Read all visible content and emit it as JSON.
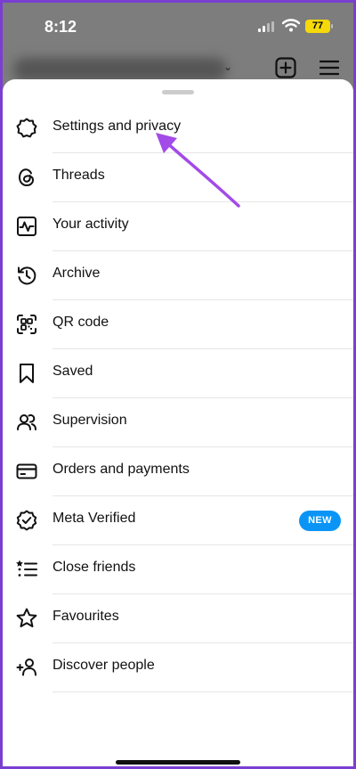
{
  "status": {
    "time": "8:12",
    "battery": "77"
  },
  "header": {
    "create_icon": "plus-square-icon",
    "menu_icon": "hamburger-icon"
  },
  "menu": {
    "items": [
      {
        "label": "Settings and privacy",
        "icon": "gear-icon"
      },
      {
        "label": "Threads",
        "icon": "threads-icon"
      },
      {
        "label": "Your activity",
        "icon": "activity-icon"
      },
      {
        "label": "Archive",
        "icon": "archive-icon"
      },
      {
        "label": "QR code",
        "icon": "qr-code-icon"
      },
      {
        "label": "Saved",
        "icon": "bookmark-icon"
      },
      {
        "label": "Supervision",
        "icon": "supervision-icon"
      },
      {
        "label": "Orders and payments",
        "icon": "card-icon"
      },
      {
        "label": "Meta Verified",
        "icon": "verified-icon",
        "badge": "NEW"
      },
      {
        "label": "Close friends",
        "icon": "close-friends-icon"
      },
      {
        "label": "Favourites",
        "icon": "star-icon"
      },
      {
        "label": "Discover people",
        "icon": "add-person-icon"
      }
    ]
  },
  "colors": {
    "badge": "#0A95F6",
    "annotation_arrow": "#A24BE8",
    "frame_border": "#7A3FD0"
  }
}
